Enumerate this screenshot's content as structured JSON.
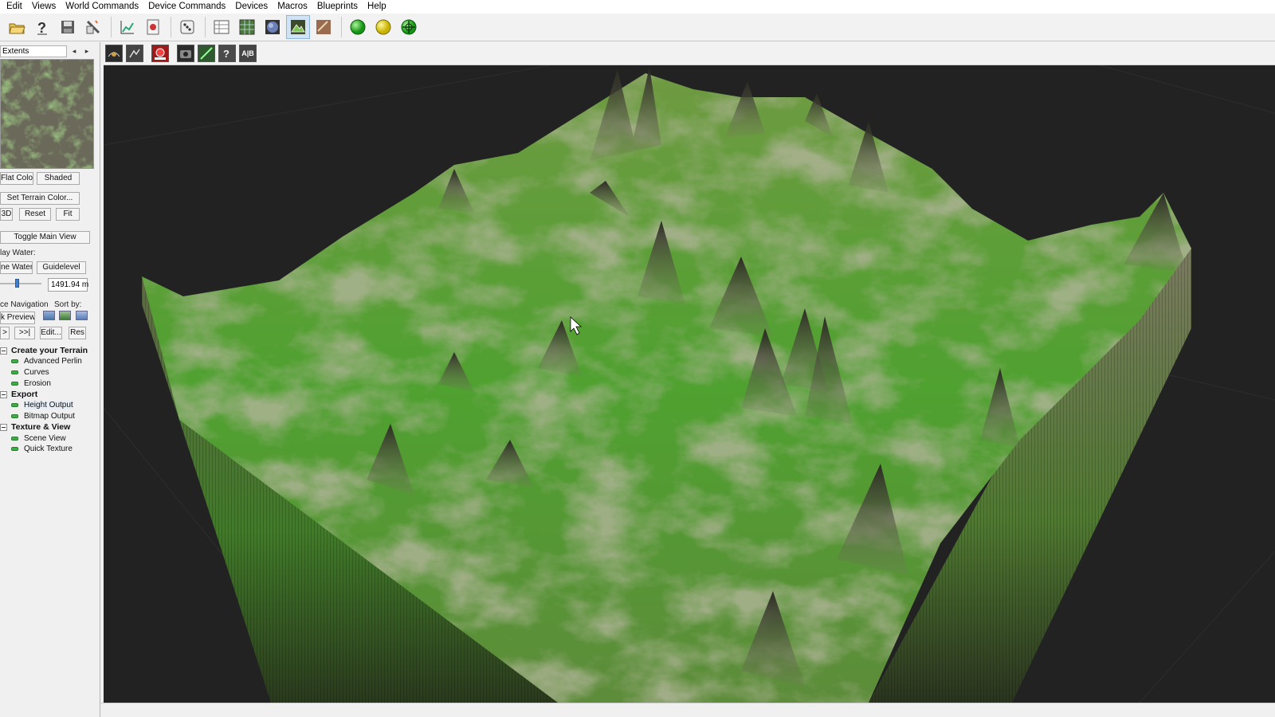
{
  "menu": [
    "Edit",
    "Views",
    "World Commands",
    "Device Commands",
    "Devices",
    "Macros",
    "Blueprints",
    "Help"
  ],
  "toolbar": {
    "icons": [
      "open-folder-icon",
      "help-icon",
      "save-icon",
      "wand-icon",
      "chart-icon",
      "report-icon",
      "dice-icon",
      "grid-icon",
      "map-icon",
      "globe-icon",
      "terrain-icon",
      "texture-icon",
      "green-ball-icon",
      "yellow-ball-icon",
      "network-ball-icon"
    ],
    "colors": {
      "green": "#22a822",
      "yellow": "#e6d21a"
    }
  },
  "left_panel": {
    "header": "Extents",
    "flat_color": "Flat Color",
    "shaded": "Shaded",
    "set_terrain_color": "Set Terrain Color...",
    "btn_3d": "3D",
    "reset": "Reset",
    "fit": "Fit",
    "toggle_main_view": "Toggle Main View",
    "display_water": "lay Water:",
    "define_water": "ne Water",
    "guidelevel": "Guidelevel",
    "water_level": "1491.94 m",
    "device_navigation": "ce Navigation",
    "sort_by": "Sort by:",
    "quick_preview": "k Preview",
    "prev": ">",
    "next": ">>|",
    "edit": "Edit...",
    "res": "Res"
  },
  "tree": [
    {
      "group": "Create your Terrain",
      "items": [
        "Advanced Perlin",
        "Curves",
        "Erosion"
      ]
    },
    {
      "group": "Export",
      "items": [
        "Height Output",
        "Bitmap Output"
      ]
    },
    {
      "group": "Texture & View",
      "items": [
        "Scene View",
        "Quick Texture"
      ]
    }
  ],
  "viewport_toolbar": [
    "Orbit",
    "Fly",
    "Render",
    "Camera",
    "Slope",
    "Help",
    "A|B"
  ],
  "viewport": {
    "background": "#222222",
    "terrain_top": "#5fae3a",
    "terrain_rock": "#6b6a58"
  }
}
